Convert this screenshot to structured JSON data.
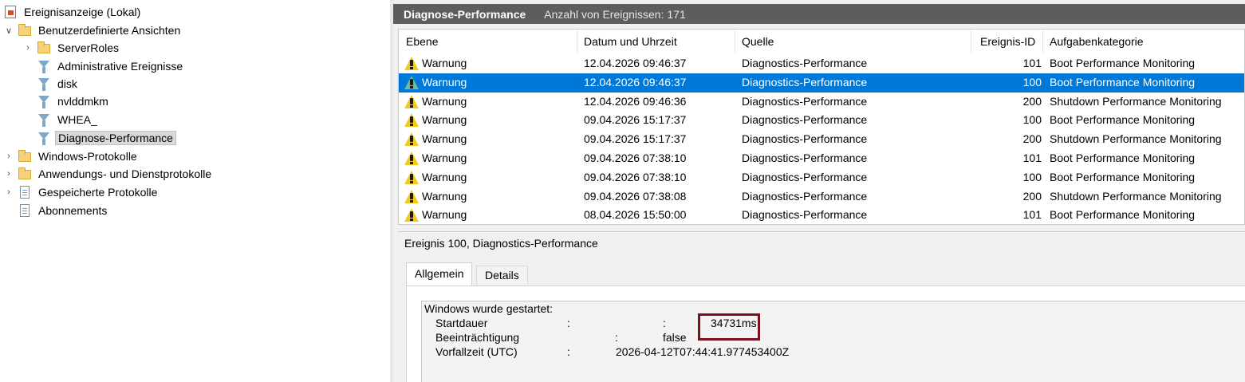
{
  "tree": {
    "root_label": "Ereignisanzeige (Lokal)",
    "custom_views_label": "Benutzerdefinierte Ansichten",
    "children": [
      {
        "label": "ServerRoles",
        "icon": "folder-icon"
      },
      {
        "label": "Administrative Ereignisse",
        "icon": "filter-icon"
      },
      {
        "label": "disk",
        "icon": "filter-icon"
      },
      {
        "label": "nvlddmkm",
        "icon": "filter-icon"
      },
      {
        "label": "WHEA_",
        "icon": "filter-icon"
      },
      {
        "label": "Diagnose-Performance",
        "icon": "filter-icon",
        "selected": true
      }
    ],
    "windows_logs_label": "Windows-Protokolle",
    "app_logs_label": "Anwendungs- und Dienstprotokolle",
    "saved_logs_label": "Gespeicherte Protokolle",
    "subscriptions_label": "Abonnements"
  },
  "header": {
    "title": "Diagnose-Performance",
    "count_text": "Anzahl von Ereignissen: 171"
  },
  "columns": [
    "Ebene",
    "Datum und Uhrzeit",
    "Quelle",
    "Ereignis-ID",
    "Aufgabenkategorie"
  ],
  "events": [
    {
      "level": "Warnung",
      "date": "12.04.2026 09:46:37",
      "source": "Diagnostics-Performance",
      "id": "101",
      "category": "Boot Performance Monitoring"
    },
    {
      "level": "Warnung",
      "date": "12.04.2026 09:46:37",
      "source": "Diagnostics-Performance",
      "id": "100",
      "category": "Boot Performance Monitoring",
      "selected": true
    },
    {
      "level": "Warnung",
      "date": "12.04.2026 09:46:36",
      "source": "Diagnostics-Performance",
      "id": "200",
      "category": "Shutdown Performance Monitoring"
    },
    {
      "level": "Warnung",
      "date": "09.04.2026 15:17:37",
      "source": "Diagnostics-Performance",
      "id": "100",
      "category": "Boot Performance Monitoring"
    },
    {
      "level": "Warnung",
      "date": "09.04.2026 15:17:37",
      "source": "Diagnostics-Performance",
      "id": "200",
      "category": "Shutdown Performance Monitoring"
    },
    {
      "level": "Warnung",
      "date": "09.04.2026 07:38:10",
      "source": "Diagnostics-Performance",
      "id": "101",
      "category": "Boot Performance Monitoring"
    },
    {
      "level": "Warnung",
      "date": "09.04.2026 07:38:10",
      "source": "Diagnostics-Performance",
      "id": "100",
      "category": "Boot Performance Monitoring"
    },
    {
      "level": "Warnung",
      "date": "09.04.2026 07:38:08",
      "source": "Diagnostics-Performance",
      "id": "200",
      "category": "Shutdown Performance Monitoring"
    },
    {
      "level": "Warnung",
      "date": "08.04.2026 15:50:00",
      "source": "Diagnostics-Performance",
      "id": "101",
      "category": "Boot Performance Monitoring"
    }
  ],
  "detail": {
    "title": "Ereignis 100, Diagnostics-Performance",
    "tab_general": "Allgemein",
    "tab_details": "Details",
    "line1": "Windows wurde gestartet:",
    "startdauer_label": "Startdauer",
    "colon": ":",
    "startdauer_value": "34731ms",
    "beeintraechtigung_label": "Beeinträchtigung",
    "beeintraechtigung_value": "false",
    "vorfallzeit_label": "Vorfallzeit (UTC)",
    "vorfallzeit_value": "2026-04-12T07:44:41.977453400Z"
  },
  "colors": {
    "selection": "#0078d7",
    "header_bar": "#5d5d5d",
    "highlight_box": "#7b1020",
    "warning": "#f2c81b"
  }
}
